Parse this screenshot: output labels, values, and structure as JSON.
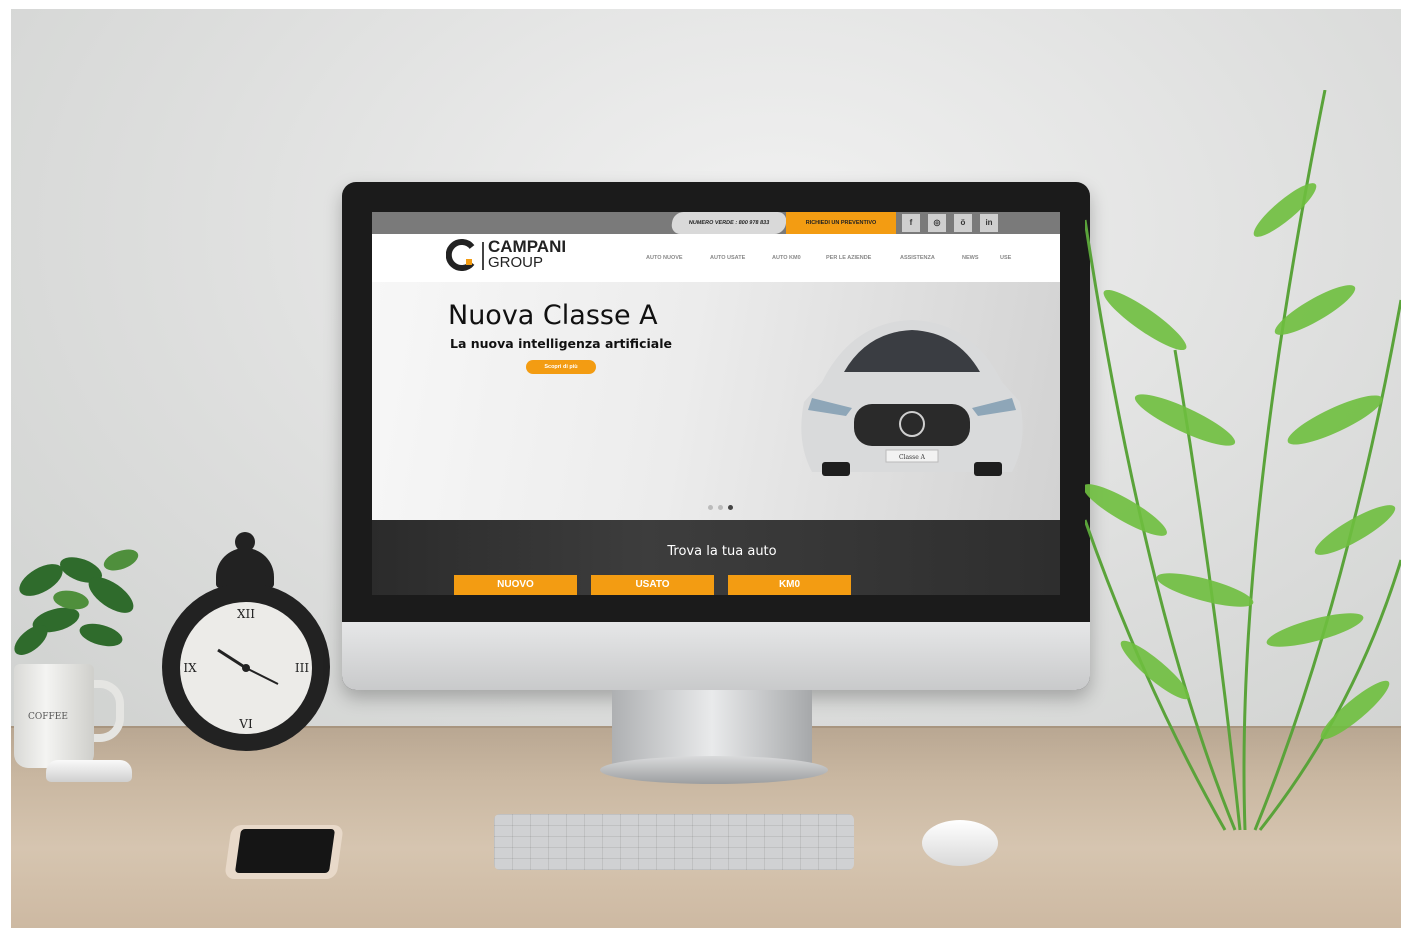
{
  "site": {
    "topbar": {
      "phone_label": "NUMERO VERDE : 800 978 833",
      "quote_label": "RICHIEDI UN PREVENTIVO",
      "social": [
        "f",
        "◎",
        "ö",
        "in"
      ]
    },
    "logo": {
      "line1": "CAMPANI",
      "line2": "GROUP"
    },
    "menu": [
      "AUTO NUOVE",
      "AUTO USATE",
      "AUTO KM0",
      "PER LE AZIENDE",
      "ASSISTENZA",
      "NEWS",
      "USE"
    ],
    "hero": {
      "title": "Nuova Classe A",
      "subtitle": "La nuova intelligenza artificiale",
      "cta": "Scopri di più",
      "plate": "Classe A"
    },
    "finder": {
      "title": "Trova la tua auto",
      "buttons": [
        "NUOVO",
        "USATO",
        "KM0"
      ]
    }
  },
  "scene": {
    "mug_text": "COFFEE",
    "accent_color": "#f39c12"
  }
}
